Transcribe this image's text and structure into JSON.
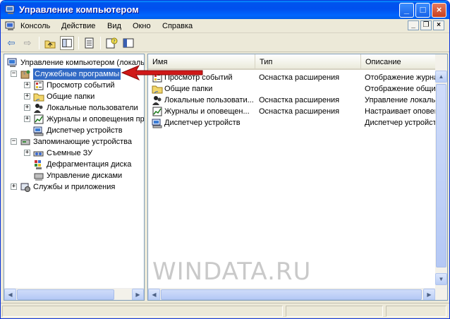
{
  "window": {
    "title": "Управление компьютером"
  },
  "menu": [
    "Консоль",
    "Действие",
    "Вид",
    "Окно",
    "Справка"
  ],
  "tree": [
    {
      "label": "Управление компьютером (локаль",
      "level": 0,
      "expander": "",
      "icon": "computer-management-icon"
    },
    {
      "label": "Служебные программы",
      "level": 1,
      "expander": "−",
      "icon": "system-tools-icon",
      "selected": true
    },
    {
      "label": "Просмотр событий",
      "level": 2,
      "expander": "+",
      "icon": "event-viewer-icon"
    },
    {
      "label": "Общие папки",
      "level": 2,
      "expander": "+",
      "icon": "shared-folders-icon"
    },
    {
      "label": "Локальные пользователи",
      "level": 2,
      "expander": "+",
      "icon": "local-users-icon"
    },
    {
      "label": "Журналы и оповещения пр",
      "level": 2,
      "expander": "+",
      "icon": "performance-logs-icon"
    },
    {
      "label": "Диспетчер устройств",
      "level": 2,
      "expander": "",
      "icon": "device-manager-icon"
    },
    {
      "label": "Запоминающие устройства",
      "level": 1,
      "expander": "−",
      "icon": "storage-icon"
    },
    {
      "label": "Съемные ЗУ",
      "level": 2,
      "expander": "+",
      "icon": "removable-storage-icon"
    },
    {
      "label": "Дефрагментация диска",
      "level": 2,
      "expander": "",
      "icon": "defrag-icon"
    },
    {
      "label": "Управление дисками",
      "level": 2,
      "expander": "",
      "icon": "disk-management-icon"
    },
    {
      "label": "Службы и приложения",
      "level": 1,
      "expander": "+",
      "icon": "services-apps-icon"
    }
  ],
  "list": {
    "columns": [
      "Имя",
      "Тип",
      "Описание"
    ],
    "rows": [
      {
        "name": "Просмотр событий",
        "type": "Оснастка расширения",
        "desc": "Отображение журнала",
        "icon": "event-viewer-icon"
      },
      {
        "name": "Общие папки",
        "type": "",
        "desc": "Отображение общих па",
        "icon": "shared-folders-icon"
      },
      {
        "name": "Локальные пользовати...",
        "type": "Оснастка расширения",
        "desc": "Управление локальны",
        "icon": "local-users-icon"
      },
      {
        "name": "Журналы и оповещен...",
        "type": "Оснастка расширения",
        "desc": "Настраивает оповеще",
        "icon": "performance-logs-icon"
      },
      {
        "name": "Диспетчер устройств",
        "type": "",
        "desc": "Диспетчер устройств",
        "icon": "device-manager-icon"
      }
    ]
  },
  "watermark": "WINDATA.RU",
  "colors": {
    "titlebar": "#0053ee",
    "selection": "#316ac5",
    "arrow": "#d01818"
  }
}
